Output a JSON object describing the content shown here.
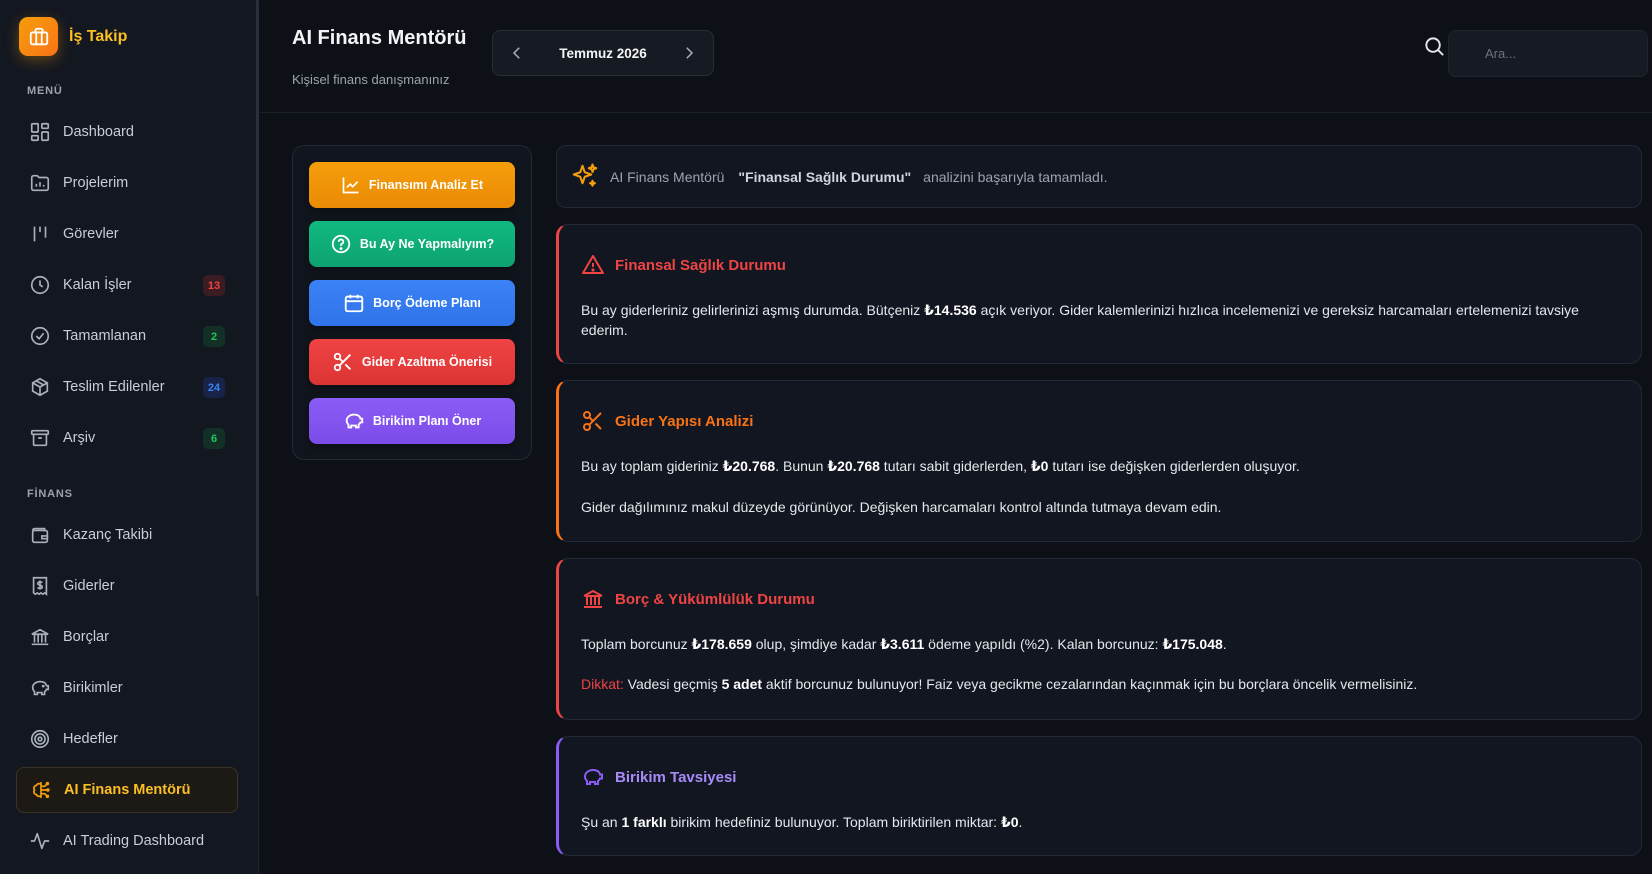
{
  "app": {
    "name": "İş Takip"
  },
  "sidebar": {
    "menu_label": "MENÜ",
    "menu_items": [
      {
        "label": "Dashboard",
        "icon": "dashboard-icon"
      },
      {
        "label": "Projelerim",
        "icon": "folder-icon"
      },
      {
        "label": "Görevler",
        "icon": "columns-icon"
      },
      {
        "label": "Kalan İşler",
        "icon": "clock-icon",
        "badge": "13"
      },
      {
        "label": "Tamamlanan",
        "icon": "check-circle-icon",
        "badge": "2"
      },
      {
        "label": "Teslim Edilenler",
        "icon": "package-icon",
        "badge": "24"
      },
      {
        "label": "Arşiv",
        "icon": "archive-icon",
        "badge": "6"
      }
    ],
    "finance_label": "FİNANS",
    "finance_items": [
      {
        "label": "Kazanç Takibi",
        "icon": "wallet-icon"
      },
      {
        "label": "Giderler",
        "icon": "receipt-icon"
      },
      {
        "label": "Borçlar",
        "icon": "bank-icon"
      },
      {
        "label": "Birikimler",
        "icon": "piggy-bank-icon"
      },
      {
        "label": "Hedefler",
        "icon": "target-icon"
      },
      {
        "label": "AI Finans Mentörü",
        "icon": "brain-icon",
        "active": true
      },
      {
        "label": "AI Trading Dashboard",
        "icon": "activity-icon"
      }
    ]
  },
  "header": {
    "title": "AI Finans Mentörü",
    "subtitle": "Kişisel finans danışmanınız",
    "month": "Temmuz 2026",
    "search_placeholder": "Ara..."
  },
  "actions": [
    {
      "label": "Finansımı Analiz Et",
      "color": "#f59e0b",
      "icon": "chart-line-icon"
    },
    {
      "label": "Bu Ay Ne Yapmalıyım?",
      "color": "#10b981",
      "icon": "help-circle-icon"
    },
    {
      "label": "Borç Ödeme Planı",
      "color": "#3b82f6",
      "icon": "calendar-icon"
    },
    {
      "label": "Gider Azaltma Önerisi",
      "color": "#ef4444",
      "icon": "scissors-icon"
    },
    {
      "label": "Birikim Planı Öner",
      "color": "#8b5cf6",
      "icon": "piggy-bank-icon"
    }
  ],
  "notice": {
    "prefix": "AI Finans Mentörü",
    "highlight": "\"Finansal Sağlık Durumu\"",
    "suffix": "analizini başarıyla tamamladı."
  },
  "cards": {
    "health": {
      "title": "Finansal Sağlık Durumu",
      "t1": "Bu ay giderleriniz gelirlerinizi aşmış durumda. Bütçeniz ",
      "amount": "₺14.536",
      "t2": " açık veriyor. Gider kalemlerinizi hızlıca incelemenizi ve gereksiz harcamaları ertelemenizi tavsiye ederim."
    },
    "expense": {
      "title": "Gider Yapısı Analizi",
      "t1": "Bu ay toplam gideriniz ",
      "total": "₺20.768",
      "t2": ". Bunun ",
      "fixed": "₺20.768",
      "t3": " tutarı sabit giderlerden, ",
      "variable": "₺0",
      "t4": " tutarı ise değişken giderlerden oluşuyor.",
      "p2": "Gider dağılımınız makul düzeyde görünüyor. Değişken harcamaları kontrol altında tutmaya devam edin."
    },
    "debt": {
      "title": "Borç & Yükümlülük Durumu",
      "t1": "Toplam borcunuz ",
      "total": "₺178.659",
      "t2": " olup, şimdiye kadar ",
      "paid": "₺3.611",
      "t3": " ödeme yapıldı (%2). Kalan borcunuz: ",
      "remaining": "₺175.048",
      "t4": ".",
      "warn_label": "Dikkat:",
      "w1": " Vadesi geçmiş ",
      "overdue": "5 adet",
      "w2": " aktif borcunuz bulunuyor! Faiz veya gecikme cezalarından kaçınmak için bu borçlara öncelik vermelisiniz."
    },
    "savings": {
      "title": "Birikim Tavsiyesi",
      "t1": "Şu an ",
      "count": "1 farklı",
      "t2": " birikim hedefiniz bulunuyor. Toplam biriktirilen miktar: ",
      "amount": "₺0",
      "t3": "."
    }
  }
}
